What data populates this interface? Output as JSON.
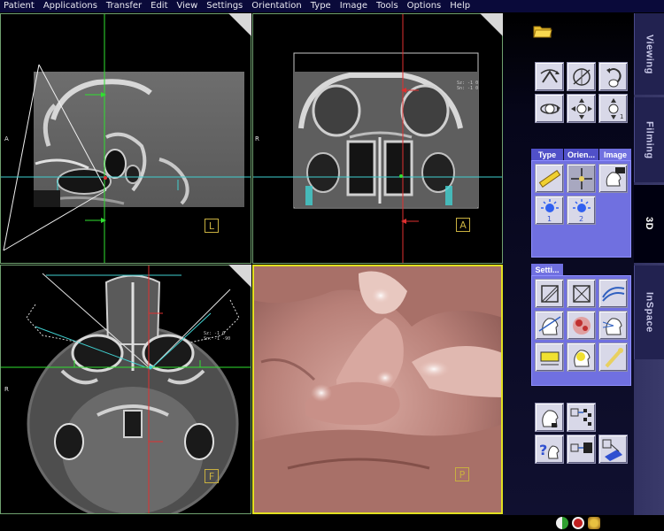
{
  "menu": [
    "Patient",
    "Applications",
    "Transfer",
    "Edit",
    "View",
    "Settings",
    "Orientation",
    "Type",
    "Image",
    "Tools",
    "Options",
    "Help"
  ],
  "viewports": {
    "sagittal": {
      "left_label": "A",
      "orient_box": "L"
    },
    "coronal": {
      "left_label": "R",
      "orient_box": "A",
      "overlay": [
        "Sz: -1  0",
        "Sn:  -1  0"
      ]
    },
    "axial": {
      "left_label": "R",
      "orient_box": "F",
      "overlay": [
        "Sz: -1  0",
        "Sn:  -1  -90"
      ]
    },
    "volume": {
      "orient_box": "P"
    }
  },
  "panel": {
    "tabs": [
      "Viewing",
      "Filming",
      "3D",
      "InSpace"
    ],
    "active_tab": "3D",
    "type_group_tabs": [
      "Type",
      "Orien...",
      "Image"
    ],
    "settings_group_tab": "Setti...",
    "light_labels": [
      "1",
      "2"
    ],
    "open_folder_icon": "folder-open-icon"
  },
  "colors": {
    "panel_group": "#7070e0",
    "crosshair_green": "#30e030",
    "crosshair_red": "#e03030",
    "crosshair_cyan": "#40d0d0",
    "viewport_border_green": "#6fa06f",
    "viewport_border_yellow": "#e0e020",
    "orient_box": "#c8b040"
  }
}
